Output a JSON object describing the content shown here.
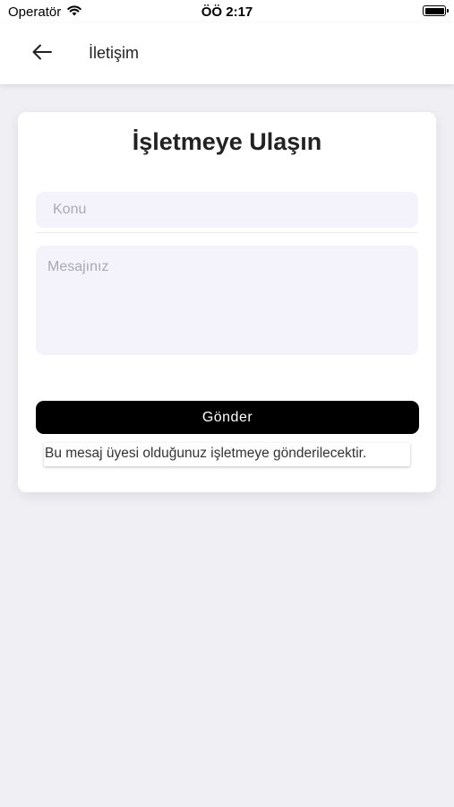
{
  "status_bar": {
    "carrier": "Operatör",
    "time": "ÖÖ 2:17",
    "wifi_icon": "wifi-icon",
    "battery_icon": "battery-icon",
    "battery_level": 1.0
  },
  "header": {
    "back_icon": "arrow-left-icon",
    "title": "İletişim"
  },
  "form": {
    "title": "İşletmeye Ulaşın",
    "subject": {
      "value": "",
      "placeholder": "Konu"
    },
    "message": {
      "value": "",
      "placeholder": "Mesajınız"
    },
    "send_label": "Gönder",
    "note": "Bu mesaj üyesi olduğunuz işletmeye gönderilecektir."
  },
  "colors": {
    "page_background": "#efeff4",
    "input_background": "#f4f3fb",
    "button_background": "#000000",
    "button_text": "#ffffff"
  }
}
